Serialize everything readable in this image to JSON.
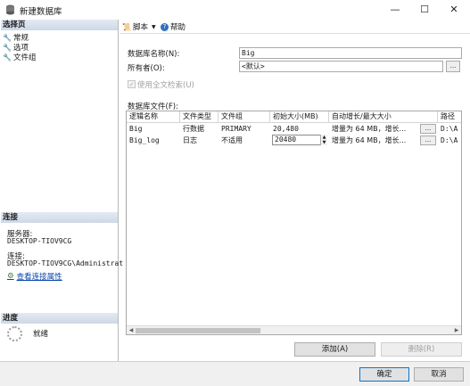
{
  "window": {
    "title": "新建数据库",
    "minimize": "—",
    "maximize": "☐",
    "close": "✕"
  },
  "left": {
    "select_page_header": "选择页",
    "nav_items": [
      {
        "label": "常规",
        "icon": "wrench-icon"
      },
      {
        "label": "选项",
        "icon": "wrench-icon"
      },
      {
        "label": "文件组",
        "icon": "wrench-icon"
      }
    ],
    "connection_header": "连接",
    "server_label": "服务器:",
    "server_value": "DESKTOP-TIOV9CG",
    "connection_label": "连接:",
    "connection_value": "DESKTOP-TIOV9CG\\Administrat",
    "view_connection_properties": "查看连接属性",
    "progress_header": "进度",
    "progress_status": "就绪"
  },
  "toolbar": {
    "script_label": "脚本",
    "help_label": "帮助"
  },
  "form": {
    "db_name_label": "数据库名称(N):",
    "db_name_value": "Big",
    "owner_label": "所有者(O):",
    "owner_value": "<默认>",
    "browse_label": "...",
    "fulltext_label": "使用全文检索(U)",
    "fulltext_checked": true,
    "files_label": "数据库文件(F):"
  },
  "files_table": {
    "columns": [
      "逻辑名称",
      "文件类型",
      "文件组",
      "初始大小(MB)",
      "自动增长/最大大小",
      "路径"
    ],
    "rows": [
      {
        "logical_name": "Big",
        "file_type": "行数据",
        "filegroup": "PRIMARY",
        "initial_size": "20,480",
        "autogrowth": "增量为 64 MB，增长...",
        "path": "D:\\A"
      },
      {
        "logical_name": "Big_log",
        "file_type": "日志",
        "filegroup": "不适用",
        "initial_size": "20480",
        "autogrowth": "增量为 64 MB，增长...",
        "path": "D:\\A"
      }
    ],
    "cell_button": "..."
  },
  "buttons": {
    "add": "添加(A)",
    "remove": "删除(R)",
    "ok": "确定",
    "cancel": "取消"
  }
}
